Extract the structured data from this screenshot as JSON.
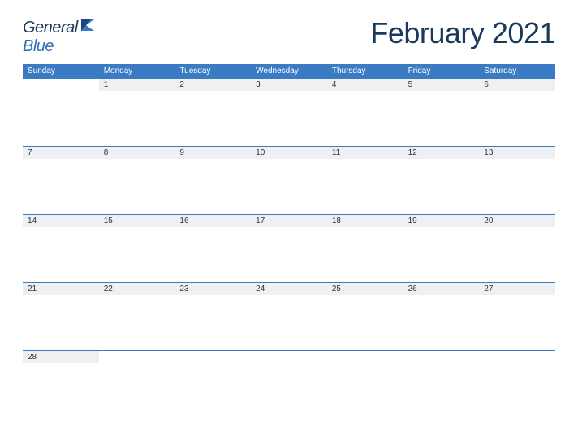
{
  "brand": {
    "part1": "General",
    "part2": "Blue"
  },
  "title": "February 2021",
  "weekdays": [
    "Sunday",
    "Monday",
    "Tuesday",
    "Wednesday",
    "Thursday",
    "Friday",
    "Saturday"
  ],
  "weeks": [
    [
      "",
      "1",
      "2",
      "3",
      "4",
      "5",
      "6"
    ],
    [
      "7",
      "8",
      "9",
      "10",
      "11",
      "12",
      "13"
    ],
    [
      "14",
      "15",
      "16",
      "17",
      "18",
      "19",
      "20"
    ],
    [
      "21",
      "22",
      "23",
      "24",
      "25",
      "26",
      "27"
    ],
    [
      "28",
      "",
      "",
      "",
      "",
      "",
      ""
    ]
  ]
}
